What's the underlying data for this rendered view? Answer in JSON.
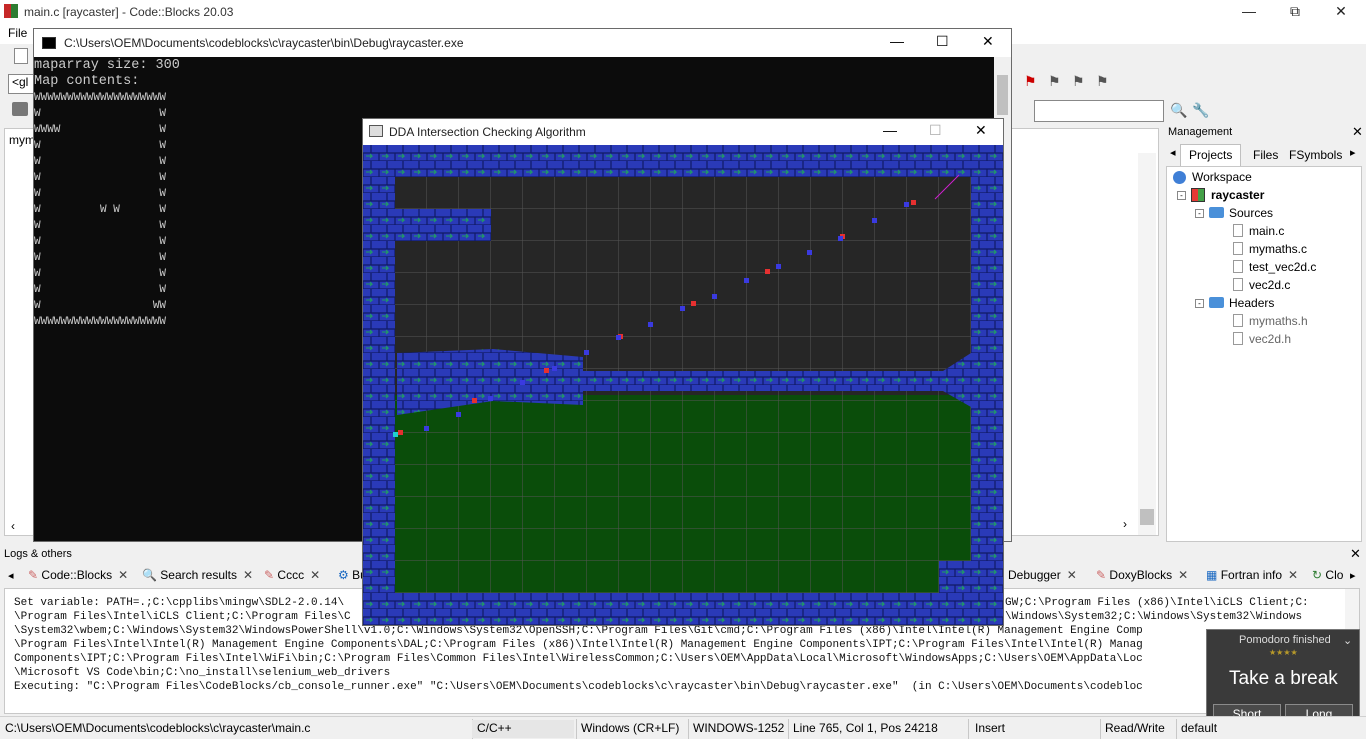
{
  "app": {
    "title": "main.c [raycaster] - Code::Blocks 20.03",
    "menu_file": "File"
  },
  "editor": {
    "tab_label": "mym"
  },
  "console": {
    "title": "C:\\Users\\OEM\\Documents\\codeblocks\\c\\raycaster\\bin\\Debug\\raycaster.exe",
    "lines": [
      "maparray size: 300",
      "Map contents:",
      "WWWWWWWWWWWWWWWWWWWW",
      "W                  W",
      "WWWW               W",
      "W                  W",
      "W                  W",
      "W                  W",
      "W                  W",
      "W         W W      W",
      "W                  W",
      "W                  W",
      "W                  W",
      "W                  W",
      "W                  W",
      "W                 WW",
      "WWWWWWWWWWWWWWWWWWWW"
    ]
  },
  "dda": {
    "title": "DDA Intersection Checking Algorithm"
  },
  "management": {
    "title": "Management",
    "tabs": [
      "Projects",
      "Files",
      "FSymbols"
    ],
    "tree": {
      "workspace": "Workspace",
      "project": "raycaster",
      "sources_folder": "Sources",
      "sources": [
        "main.c",
        "mymaths.c",
        "test_vec2d.c",
        "vec2d.c"
      ],
      "headers_folder": "Headers",
      "headers": [
        "mymaths.h",
        "vec2d.h"
      ]
    }
  },
  "logs": {
    "title": "Logs & others",
    "tabs": [
      "Code::Blocks",
      "Search results",
      "Cccc",
      "Bu",
      "Debugger",
      "DoxyBlocks",
      "Fortran info",
      "Clo"
    ],
    "lines": [
      "Set variable: PATH=.;C:\\cpplibs\\mingw\\SDL2-2.0.14\\",
      "\\Program Files\\Intel\\iCLS Client;C:\\Program Files\\C",
      "\\System32\\wbem;C:\\Windows\\System32\\WindowsPowerShell\\v1.0;C:\\Windows\\System32\\OpenSSH;C:\\Program Files\\Git\\cmd;C:\\Program Files (x86)\\Intel\\Intel(R) Management Engine Comp",
      "\\Program Files\\Intel\\Intel(R) Management Engine Components\\DAL;C:\\Program Files (x86)\\Intel\\Intel(R) Management Engine Components\\IPT;C:\\Program Files\\Intel\\Intel(R) Manag",
      "Components\\IPT;C:\\Program Files\\Intel\\WiFi\\bin;C:\\Program Files\\Common Files\\Intel\\WirelessCommon;C:\\Users\\OEM\\AppData\\Local\\Microsoft\\WindowsApps;C:\\Users\\OEM\\AppData\\Loc",
      "\\Microsoft VS Code\\bin;C:\\no_install\\selenium_web_drivers",
      "Executing: \"C:\\Program Files\\CodeBlocks/cb_console_runner.exe\" \"C:\\Users\\OEM\\Documents\\codeblocks\\c\\raycaster\\bin\\Debug\\raycaster.exe\"  (in C:\\Users\\OEM\\Documents\\codebloc"
    ],
    "right_fragment_1": "GW;C:\\Program Files (x86)\\Intel\\iCLS Client;C:",
    "right_fragment_2": "\\Windows\\System32;C:\\Windows\\System32\\Windows"
  },
  "pomodoro": {
    "title": "Pomodoro finished",
    "stars": "★★★★",
    "message": "Take a break",
    "short_label": "Short",
    "long_label": "Long"
  },
  "status": {
    "path": "C:\\Users\\OEM\\Documents\\codeblocks\\c\\raycaster\\main.c",
    "language": "C/C++",
    "eol": "Windows (CR+LF)",
    "encoding": "WINDOWS-1252",
    "position": "Line 765, Col 1, Pos 24218",
    "mode": "Insert",
    "access": "Read/Write",
    "profile": "default"
  },
  "colors": {
    "brick": "#2a3ab8",
    "sky": "#262626",
    "ground": "#0a4d0a",
    "ray_red": "#e53030",
    "ray_blue": "#3a3ae0",
    "ray_cyan": "#20d0d0",
    "ray_line": "#d020d0"
  }
}
